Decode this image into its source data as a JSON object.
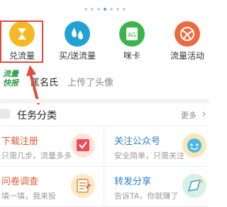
{
  "colors": {
    "accent": "#3fb8a8",
    "highlight": "#e14b3c",
    "task_red": "#e05a33",
    "task_blue": "#2a7fd4"
  },
  "pager": {
    "count": 7,
    "active_index": 3
  },
  "top_icons": [
    {
      "label": "兑流量",
      "icon": "hourglass-icon",
      "color": "#f3b824"
    },
    {
      "label": "买/送流量",
      "icon": "water-drops-icon",
      "color": "#22a2d3"
    },
    {
      "label": "咪卡",
      "icon": "card-icon",
      "color": "#3bb54a"
    },
    {
      "label": "流量活动",
      "icon": "ball-icon",
      "color": "#ec6a3f"
    }
  ],
  "news": {
    "logo_line1": "流量",
    "logo_line2": "快报",
    "name": "匡名氏",
    "action": "上传了头像"
  },
  "section": {
    "title": "任务分类",
    "more": "更多"
  },
  "tasks": [
    {
      "title": "下载注册",
      "sub": "只需几步，流量多多",
      "color": "#e05a33",
      "icon": "calendar-check-icon"
    },
    {
      "title": "关注公众号",
      "sub": "安全简单，只需关注",
      "color": "#2a7fd4",
      "icon": "chat-bubble-icon"
    },
    {
      "title": "问卷调查",
      "sub": "填一填，我来投",
      "color": "#e05a33",
      "icon": "questionnaire-icon"
    },
    {
      "title": "转发分享",
      "sub": "告诉TA，你就赚了",
      "color": "#2a7fd4",
      "icon": "share-icon"
    }
  ]
}
